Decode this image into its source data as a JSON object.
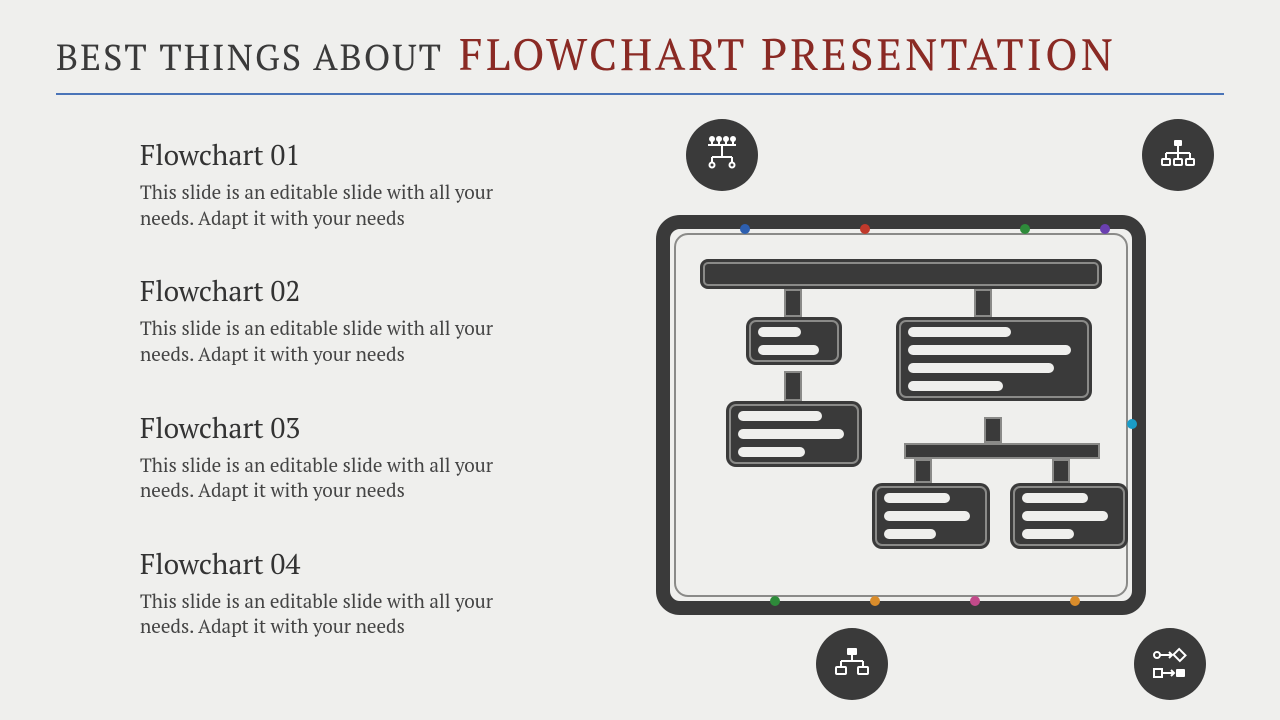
{
  "title": {
    "prefix": "BEST THINGS ABOUT",
    "main": "FLOWCHART PRESENTATION"
  },
  "items": [
    {
      "heading": "Flowchart 01",
      "body": "This slide is an editable slide with all your needs. Adapt it with your needs"
    },
    {
      "heading": "Flowchart 02",
      "body": "This slide is an editable slide with all your needs. Adapt it with your needs"
    },
    {
      "heading": "Flowchart 03",
      "body": "This slide is an editable slide with all your needs. Adapt it with your needs"
    },
    {
      "heading": "Flowchart 04",
      "body": "This slide is an editable slide with all your needs. Adapt it with your needs"
    }
  ],
  "icons": {
    "top_left": "network-tree-icon",
    "top_right": "org-chart-icon",
    "bottom_left": "hierarchy-icon",
    "bottom_right": "process-flow-icon"
  },
  "colors": {
    "accent_rule": "#4a74b8",
    "title_emphasis": "#8a2a24",
    "glyph_dark": "#3a3a3a",
    "background": "#efefed"
  }
}
